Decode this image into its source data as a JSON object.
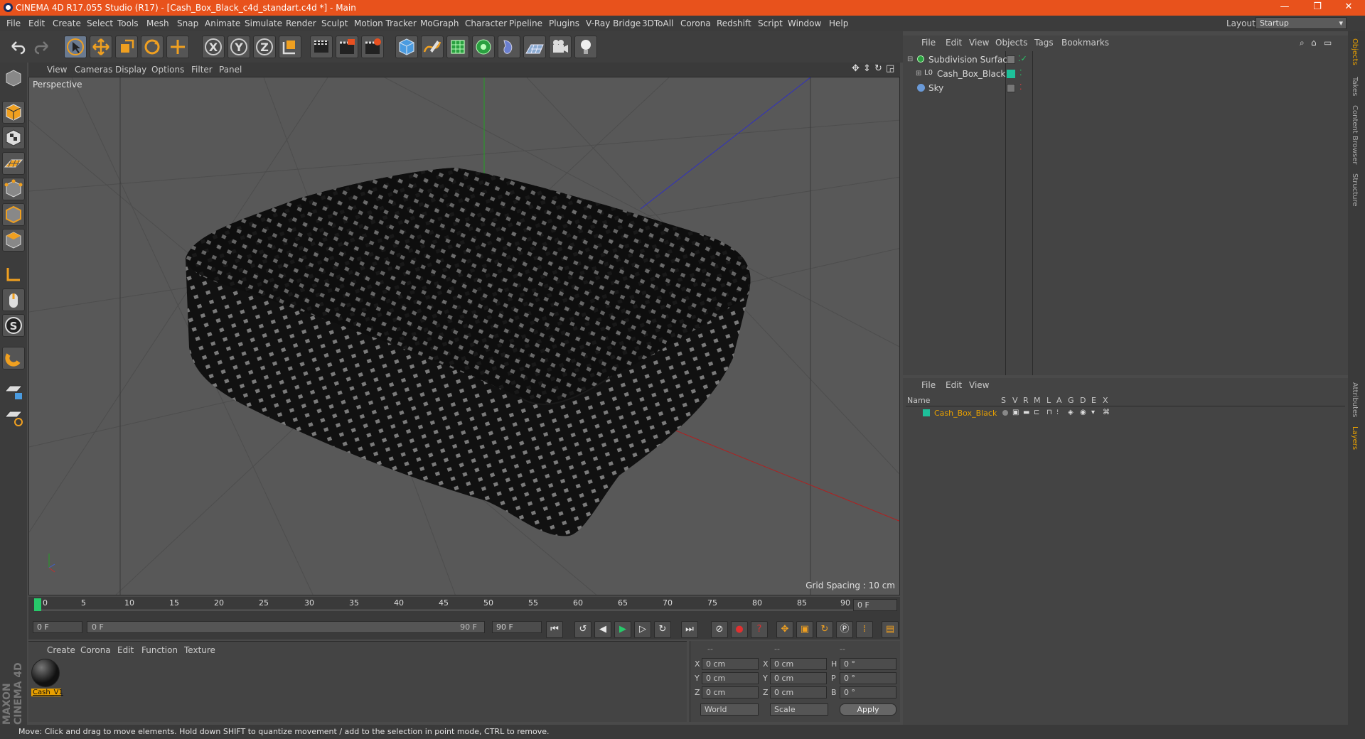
{
  "window": {
    "title": "CINEMA 4D R17.055 Studio (R17) - [Cash_Box_Black_c4d_standart.c4d *] - Main",
    "controls": {
      "minimize": "—",
      "maximize": "❐",
      "close": "✕"
    }
  },
  "menu": {
    "items": [
      "File",
      "Edit",
      "Create",
      "Select",
      "Tools",
      "Mesh",
      "Snap",
      "Animate",
      "Simulate",
      "Render",
      "Sculpt",
      "Motion Tracker",
      "MoGraph",
      "Character",
      "Pipeline",
      "Plugins",
      "V-Ray Bridge",
      "3DToAll",
      "Corona",
      "Redshift",
      "Script",
      "Window",
      "Help"
    ],
    "layout_label": "Layout:",
    "layout_value": "Startup"
  },
  "toolbar": {
    "icons": [
      "undo-icon",
      "redo-icon",
      "select-arrow-icon",
      "move-icon",
      "scale-icon",
      "rotate-icon",
      "transform-icon",
      "x-axis-icon",
      "y-axis-icon",
      "z-axis-icon",
      "coordinate-system-icon",
      "render-view-icon",
      "render-picture-viewer-icon",
      "render-settings-icon",
      "cube-icon",
      "pen-spline-icon",
      "subdivision-icon",
      "cloner-icon",
      "deformer-icon",
      "floor-icon",
      "camera-icon",
      "light-icon"
    ],
    "axis_labels": [
      "X",
      "Y",
      "Z"
    ]
  },
  "viewport": {
    "menu": [
      "View",
      "Cameras",
      "Display",
      "Options",
      "Filter",
      "Panel"
    ],
    "label": "Perspective",
    "grid_spacing": "Grid Spacing : 10 cm"
  },
  "timeline": {
    "ticks": [
      "0",
      "5",
      "10",
      "15",
      "20",
      "25",
      "30",
      "35",
      "40",
      "45",
      "50",
      "55",
      "60",
      "65",
      "70",
      "75",
      "80",
      "85",
      "90"
    ],
    "current_frame": "0 F",
    "start_field": "0 F",
    "range_start": "0 F",
    "range_end": "90 F",
    "end_field": "90 F"
  },
  "material": {
    "menu": [
      "Create",
      "Corona",
      "Edit",
      "Function",
      "Texture"
    ],
    "items": [
      {
        "name": "Cash_V1"
      }
    ]
  },
  "coordinates": {
    "headers": [
      "--",
      "--",
      "--"
    ],
    "rows": [
      {
        "a": "X",
        "av": "0 cm",
        "b": "X",
        "bv": "0 cm",
        "c": "H",
        "cv": "0 °"
      },
      {
        "a": "Y",
        "av": "0 cm",
        "b": "Y",
        "bv": "0 cm",
        "c": "P",
        "cv": "0 °"
      },
      {
        "a": "Z",
        "av": "0 cm",
        "b": "Z",
        "bv": "0 cm",
        "c": "B",
        "cv": "0 °"
      }
    ],
    "world": "World",
    "scale": "Scale",
    "apply": "Apply"
  },
  "objects": {
    "menu": [
      "File",
      "Edit",
      "View",
      "Objects",
      "Tags",
      "Bookmarks"
    ],
    "items": [
      {
        "name": "Subdivision Surface"
      },
      {
        "name": "Cash_Box_Black"
      },
      {
        "name": "Sky"
      }
    ]
  },
  "layers": {
    "menu": [
      "File",
      "Edit",
      "View"
    ],
    "header_name": "Name",
    "flags": [
      "S",
      "V",
      "R",
      "M",
      "L",
      "A",
      "G",
      "D",
      "E",
      "X"
    ],
    "items": [
      {
        "name": "Cash_Box_Black",
        "color": "#1ec09a"
      }
    ]
  },
  "right_tabs": [
    "Objects",
    "Takes",
    "Content Browser",
    "Structure",
    "Attributes",
    "Layers"
  ],
  "brand": "MAXON CINEMA 4D",
  "status": "Move: Click and drag to move elements. Hold down SHIFT to quantize movement / add to the selection in point mode, CTRL to remove.",
  "colors": {
    "title_bar": "#e8521c",
    "accent_layer": "#1ec09a",
    "material_label": "#e8a000"
  }
}
